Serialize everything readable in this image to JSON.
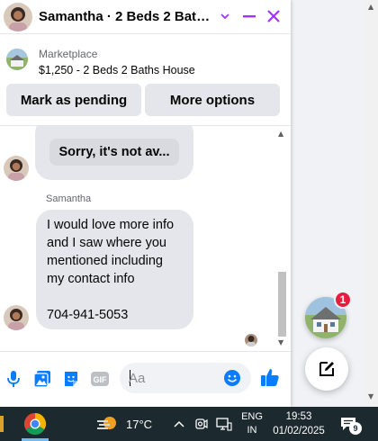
{
  "chat": {
    "title": "Samantha · 2 Beds 2 Baths...",
    "listing": {
      "source": "Marketplace",
      "item": "$1,250 - 2 Beds 2 Baths House"
    },
    "actions": {
      "mark_pending": "Mark as pending",
      "more_options": "More options"
    },
    "messages": {
      "previous_card": "Sorry, it's not av...",
      "sender": "Samantha",
      "text": "I would love more info\nand I saw where you\nmentioned including\nmy contact info\n\n704-941-5053"
    },
    "composer": {
      "placeholder": "Aa"
    },
    "colors": {
      "accent": "#a033ff",
      "messenger_blue": "#0a7cff",
      "bubble": "#e4e6eb"
    }
  },
  "floating": {
    "unread_badge": "1"
  },
  "taskbar": {
    "temperature": "17°C",
    "language": "ENG",
    "region": "IN",
    "time": "19:53",
    "date": "01/02/2025",
    "notification_count": "9"
  }
}
